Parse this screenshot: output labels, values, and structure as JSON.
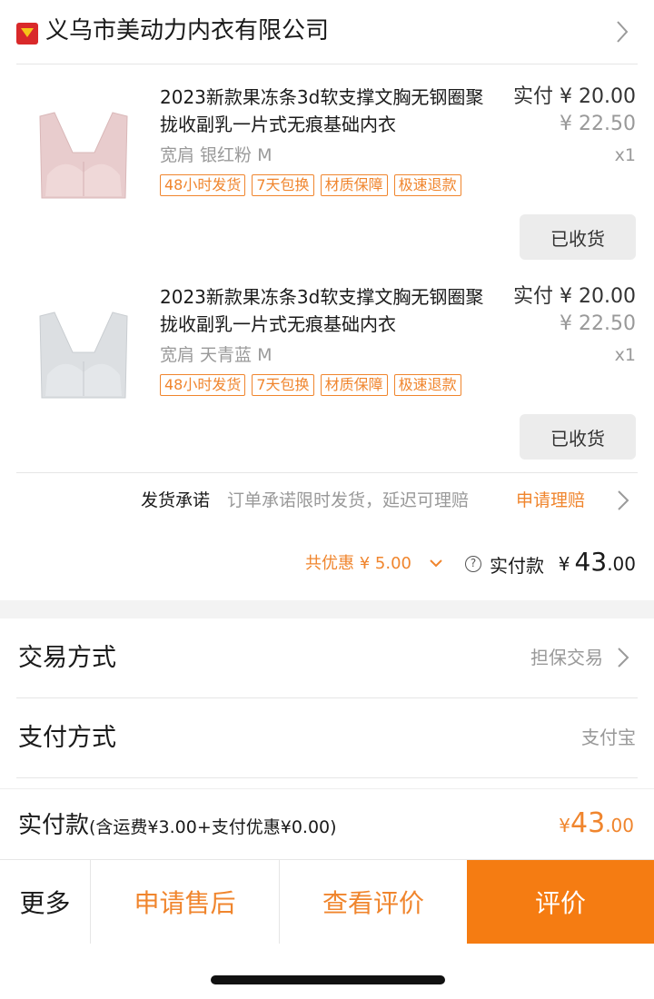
{
  "shop": {
    "name": "义乌市美动力内衣有限公司",
    "logo_icon": "shop-badge-icon"
  },
  "items": [
    {
      "title": "2023新款果冻条3d软支撑文胸无钢圈聚拢收副乳一片式无痕基础内衣",
      "price_label": "实付 ¥ 20.00",
      "original_price": "¥ 22.50",
      "sku": "宽肩 银红粉 M",
      "qty": "x1",
      "tags": [
        "48小时发货",
        "7天包换",
        "材质保障",
        "极速退款"
      ],
      "status_button": "已收货",
      "image_color": "#e9cfd0"
    },
    {
      "title": "2023新款果冻条3d软支撑文胸无钢圈聚拢收副乳一片式无痕基础内衣",
      "price_label": "实付 ¥ 20.00",
      "original_price": "¥ 22.50",
      "sku": "宽肩 天青蓝 M",
      "qty": "x1",
      "tags": [
        "48小时发货",
        "7天包换",
        "材质保障",
        "极速退款"
      ],
      "status_button": "已收货",
      "image_color": "#dde0e3"
    }
  ],
  "promise": {
    "label": "发货承诺",
    "text": "订单承诺限时发货，延迟可理赔",
    "link": "申请理赔"
  },
  "total": {
    "discount": "共优惠 ¥ 5.00",
    "paid_label": "实付款",
    "currency": "¥",
    "amount_int": "43",
    "amount_dec": ".00"
  },
  "info": [
    {
      "label": "交易方式",
      "value": "担保交易"
    },
    {
      "label": "支付方式",
      "value": "支付宝"
    }
  ],
  "summary": {
    "label": "实付款",
    "detail": "(含运费¥3.00+支付优惠¥0.00)",
    "currency": "¥",
    "amount_int": "43",
    "amount_dec": ".00"
  },
  "actions": {
    "more": "更多",
    "after_sale": "申请售后",
    "view_review": "查看评价",
    "rate": "评价"
  },
  "colors": {
    "accent": "#f57c12",
    "tag_orange": "#f0852d"
  }
}
